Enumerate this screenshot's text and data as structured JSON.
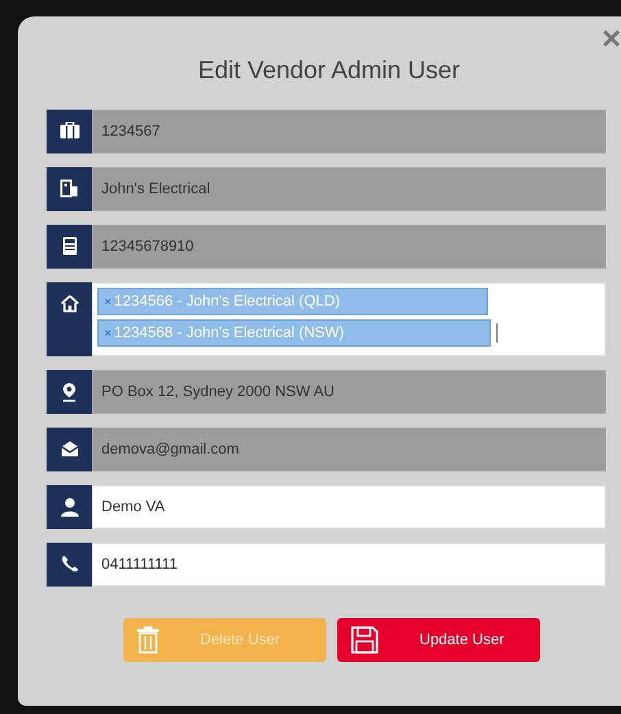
{
  "dialog": {
    "title": "Edit Vendor Admin User",
    "close": "×"
  },
  "fields": [
    {
      "kind": "text",
      "value": "1234567",
      "disabled": true
    },
    {
      "kind": "text",
      "value": "John's Electrical",
      "disabled": true
    },
    {
      "kind": "text",
      "value": "12345678910",
      "disabled": true
    },
    {
      "kind": "tags",
      "tags": [
        {
          "remove": "×",
          "label": "1234566 - John's Electrical (QLD)"
        },
        {
          "remove": "×",
          "label": "1234568 - John's Electrical (NSW)"
        }
      ],
      "disabled": false
    },
    {
      "kind": "text",
      "value": "PO Box 12, Sydney 2000 NSW AU",
      "disabled": true
    },
    {
      "kind": "text",
      "value": "demova@gmail.com",
      "disabled": true
    },
    {
      "kind": "text",
      "value": "Demo VA",
      "disabled": false
    },
    {
      "kind": "text",
      "value": "0411111111",
      "disabled": false
    }
  ],
  "buttons": [
    {
      "kind": "delete",
      "label": "Delete User"
    },
    {
      "kind": "update",
      "label": "Update User"
    }
  ]
}
